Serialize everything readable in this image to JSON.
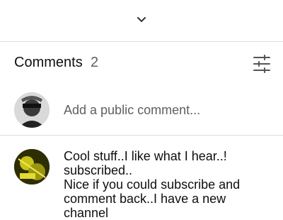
{
  "expander": {
    "icon": "chevron-down-icon"
  },
  "comments": {
    "title": "Comments",
    "count": "2",
    "filter_icon": "sort-filter-icon",
    "add_placeholder": "Add a public comment...",
    "items": [
      {
        "avatar": "user-avatar",
        "lines": [
          "Cool stuff..I like what I hear..!",
          "subscribed..",
          "Nice if you could subscribe and",
          "comment back..I have a new",
          "channel"
        ]
      }
    ]
  }
}
